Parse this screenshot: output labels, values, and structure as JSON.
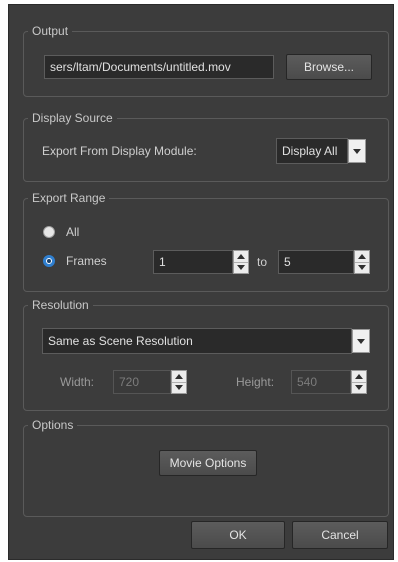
{
  "output": {
    "title": "Output",
    "path_value": "sers/ltam/Documents/untitled.mov",
    "browse_label": "Browse..."
  },
  "display_source": {
    "title": "Display Source",
    "export_from_label": "Export From Display Module:",
    "module_selected": "Display All"
  },
  "export_range": {
    "title": "Export Range",
    "all_label": "All",
    "frames_label": "Frames",
    "selected": "Frames",
    "from_value": "1",
    "to_label": "to",
    "to_value": "5"
  },
  "resolution": {
    "title": "Resolution",
    "preset_selected": "Same as Scene Resolution",
    "width_label": "Width:",
    "width_value": "720",
    "height_label": "Height:",
    "height_value": "540"
  },
  "options": {
    "title": "Options",
    "movie_options_label": "Movie Options"
  },
  "footer": {
    "ok_label": "OK",
    "cancel_label": "Cancel"
  },
  "colors": {
    "background": "#3c3c3c",
    "field_background": "#2a2a2a",
    "radio_accent": "#2f7fd0"
  }
}
